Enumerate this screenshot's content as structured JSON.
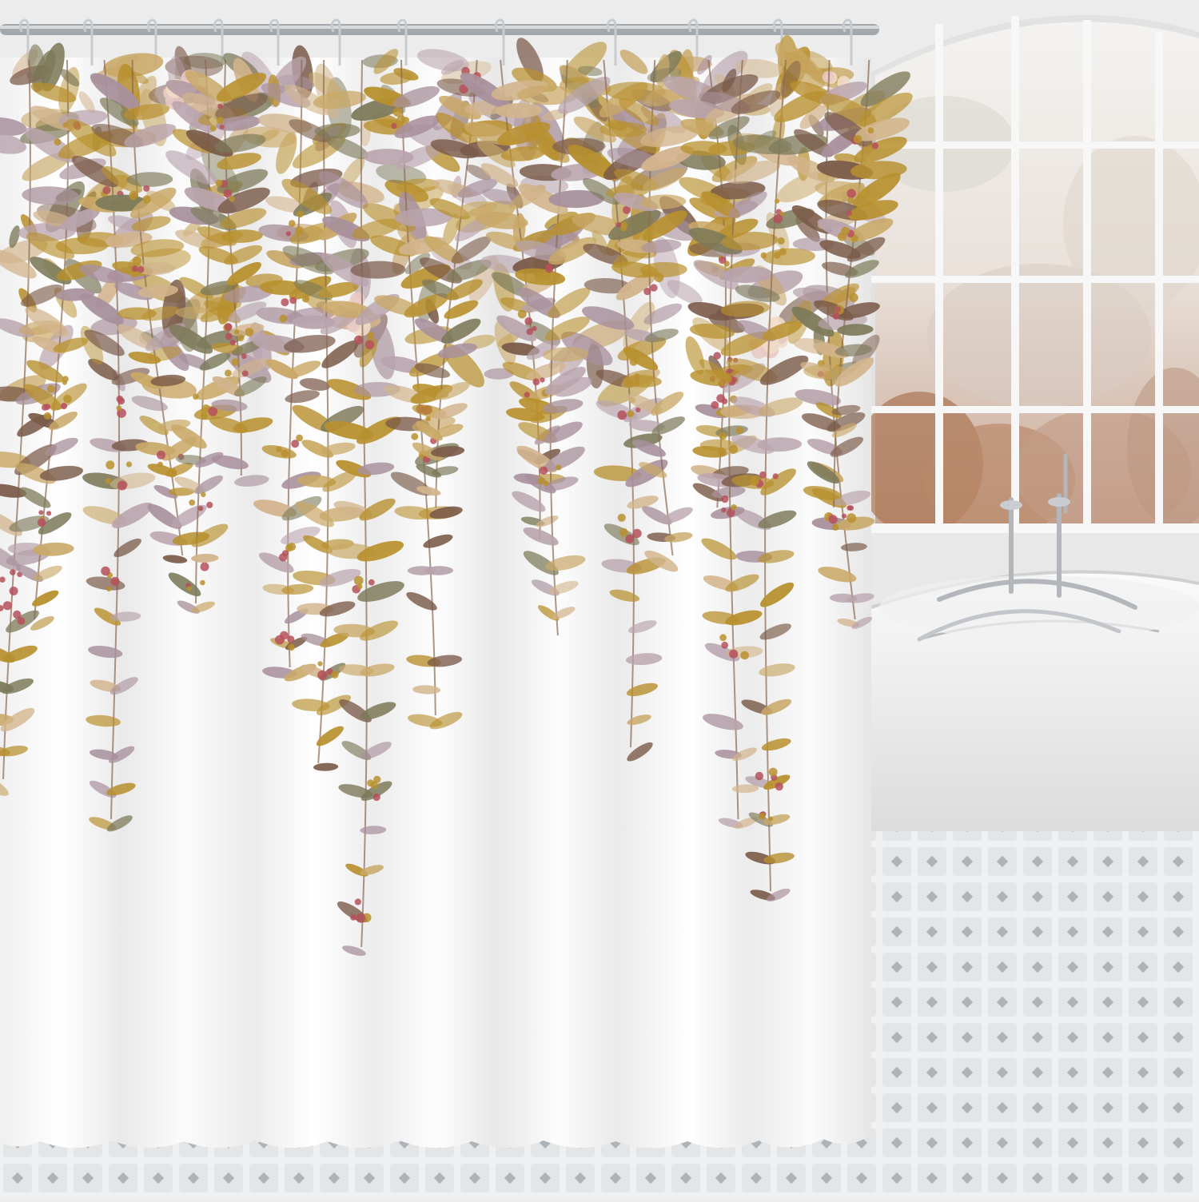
{
  "scene": {
    "subject": "shower-curtain-product-photo",
    "colors": {
      "curtain_white": "#f7f7f7",
      "leaf_gold": "#b8902e",
      "leaf_mauve": "#b9a3ad",
      "leaf_brown": "#7a5a48",
      "leaf_olive": "#7d7a5a",
      "berry_red": "#b5505a",
      "rod_silver": "#9aa0a6",
      "window_foliage": "#b48a6e",
      "tile_grey": "#c9cdd1"
    },
    "hook_count": 12
  }
}
